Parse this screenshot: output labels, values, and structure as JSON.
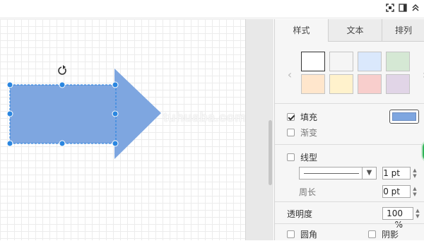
{
  "tabs": [
    {
      "label": "样式",
      "active": true
    },
    {
      "label": "文本",
      "active": false
    },
    {
      "label": "排列",
      "active": false
    }
  ],
  "swatches": [
    "#ffffff",
    "#f5f5f5",
    "#dae8fc",
    "#d5e8d4",
    "#ffe6cc",
    "#fff2cc",
    "#f8cecc",
    "#e1d5e7"
  ],
  "fill": {
    "label": "填充",
    "checked": true,
    "color": "#7ea6e0"
  },
  "gradient": {
    "label": "渐变",
    "checked": false
  },
  "line": {
    "label": "线型",
    "checked": false,
    "width_value": "1 pt"
  },
  "perimeter": {
    "label": "周长",
    "value": "0 pt"
  },
  "opacity": {
    "label": "透明度",
    "value": "100 %"
  },
  "rounded": {
    "label": "圆角",
    "checked": false
  },
  "shadow": {
    "label": "阴影",
    "checked": false
  },
  "watermark": "tuhuaba.com",
  "shape_color": "#7ea6e0"
}
